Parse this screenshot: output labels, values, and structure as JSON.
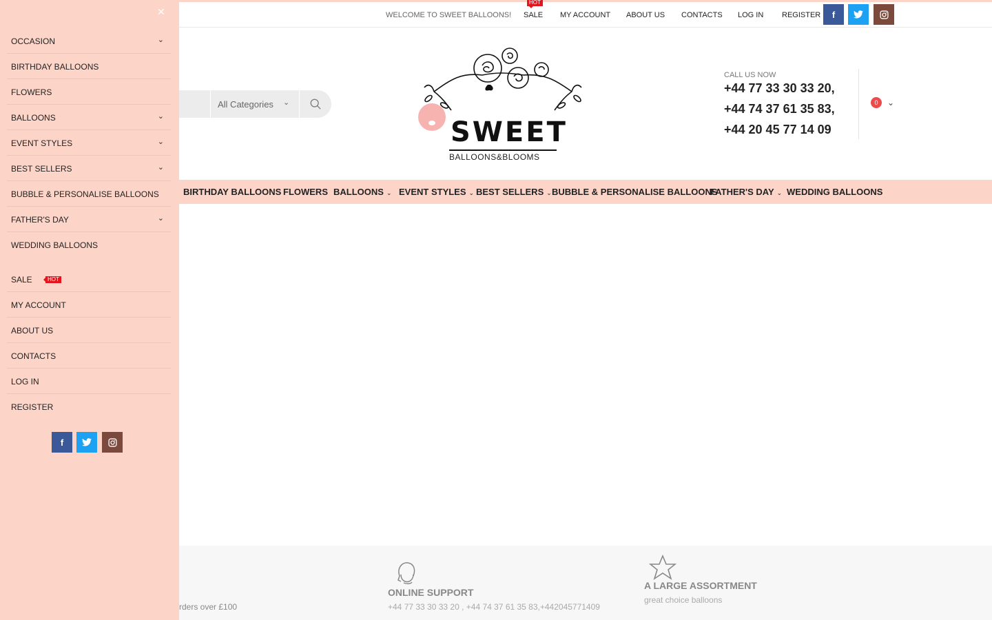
{
  "topbar": {
    "welcome": "WELCOME TO SWEET BALLOONS!",
    "hot_badge": "HOT",
    "links": [
      {
        "label": "SALE"
      },
      {
        "label": "MY ACCOUNT"
      },
      {
        "label": "ABOUT US"
      },
      {
        "label": "CONTACTS"
      },
      {
        "label": "LOG IN"
      },
      {
        "label": "REGISTER"
      }
    ],
    "social": {
      "facebook": "f",
      "twitter": "t",
      "instagram": "ig"
    }
  },
  "header": {
    "search": {
      "category": "All Categories"
    },
    "logo": {
      "brand": "SWEET",
      "tagline": "BALLOONS&BLOOMS"
    },
    "call_label": "CALL US NOW",
    "phones": [
      "+44 77 33 30 33 20,",
      "+44 74 37 61 35 83,",
      "+44 20 45 77 14 09"
    ],
    "cart_count": "0"
  },
  "mainnav": {
    "items": [
      {
        "label": "BIRTHDAY BALLOONS",
        "dropdown": false
      },
      {
        "label": "FLOWERS",
        "dropdown": false
      },
      {
        "label": "BALLOONS",
        "dropdown": true
      },
      {
        "label": "EVENT STYLES",
        "dropdown": true
      },
      {
        "label": "BEST SELLERS",
        "dropdown": true
      },
      {
        "label": "BUBBLE & PERSONALISE BALLOONS",
        "dropdown": false
      },
      {
        "label": "FATHER'S DAY",
        "dropdown": true
      },
      {
        "label": "WEDDING BALLOONS",
        "dropdown": false
      }
    ]
  },
  "drawer": {
    "menu": [
      {
        "label": "OCCASION",
        "dropdown": true
      },
      {
        "label": "BIRTHDAY BALLOONS",
        "dropdown": false
      },
      {
        "label": "FLOWERS",
        "dropdown": false
      },
      {
        "label": "BALLOONS",
        "dropdown": true
      },
      {
        "label": "EVENT STYLES",
        "dropdown": true
      },
      {
        "label": "BEST SELLERS",
        "dropdown": true
      },
      {
        "label": "BUBBLE & PERSONALISE BALLOONS",
        "dropdown": false
      },
      {
        "label": "FATHER'S DAY",
        "dropdown": true
      },
      {
        "label": "WEDDING BALLOONS",
        "dropdown": false
      }
    ],
    "links": [
      {
        "label": "SALE"
      },
      {
        "label": "MY ACCOUNT"
      },
      {
        "label": "ABOUT US"
      },
      {
        "label": "CONTACTS"
      },
      {
        "label": "LOG IN"
      },
      {
        "label": "REGISTER"
      }
    ],
    "hot_badge": "HOT"
  },
  "features": {
    "shipping_text": "rders over £100",
    "support_title": "ONLINE SUPPORT",
    "support_text": "+44 77 33 30 33 20 , +44 74 37 61 35 83,+442045771409",
    "assortment_title": "A LARGE ASSORTMENT",
    "assortment_text": "great choice balloons"
  },
  "colors": {
    "accent": "#fcd5c8",
    "hot": "#e4161d",
    "facebook": "#3b5998",
    "twitter": "#1da1f2",
    "instagram": "#7b4a3c",
    "cart_badge": "#ec4b4b"
  }
}
